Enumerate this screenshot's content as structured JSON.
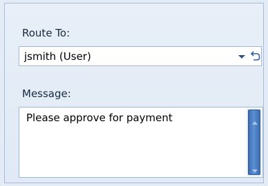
{
  "route": {
    "label": "Route To:",
    "value": "jsmith (User)",
    "dropdown_icon": "chevron-down-icon",
    "undo_icon": "undo-icon"
  },
  "message": {
    "label": "Message:",
    "value": "Please approve for payment"
  },
  "colors": {
    "panel_bg": "#e3ebf6",
    "border": "#a2b6d2",
    "scroll_thumb": "#4f7fc4"
  }
}
